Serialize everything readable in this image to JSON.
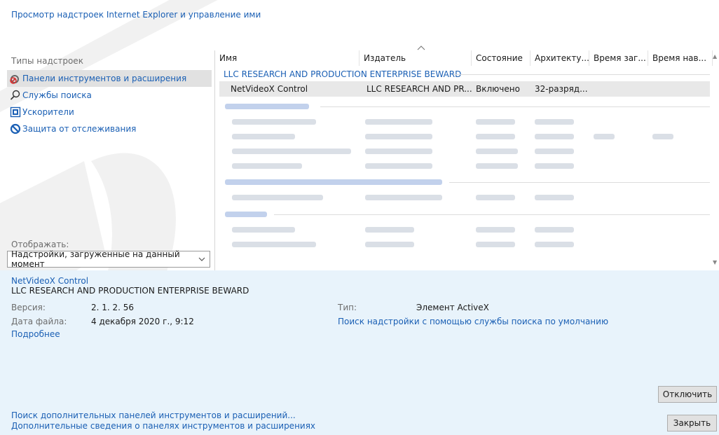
{
  "header": {
    "title": "Просмотр надстроек Internet Explorer и управление ими"
  },
  "left_panel": {
    "types_label": "Типы надстроек",
    "types": [
      {
        "label": "Панели инструментов и расширения",
        "icon": "gear-icon",
        "selected": true
      },
      {
        "label": "Службы поиска",
        "icon": "search-icon",
        "selected": false
      },
      {
        "label": "Ускорители",
        "icon": "accelerator-icon",
        "selected": false
      },
      {
        "label": "Защита от отслеживания",
        "icon": "tracking-protection-icon",
        "selected": false
      }
    ],
    "show_label": "Отображать:",
    "show_value": "Надстройки, загруженные на данный момент"
  },
  "table": {
    "columns": [
      "Имя",
      "Издатель",
      "Состояние",
      "Архитекту...",
      "Время заг...",
      "Время нав..."
    ],
    "groups": [
      {
        "title": "LLC RESEARCH AND PRODUCTION ENTERPRISE BEWARD",
        "rows": [
          {
            "name": "NetVideoX Control",
            "publisher": "LLC RESEARCH AND PR...",
            "status": "Включено",
            "arch": "32-разряд..."
          }
        ]
      }
    ]
  },
  "details": {
    "addon_name": "NetVideoX Control",
    "addon_publisher": "LLC RESEARCH AND PRODUCTION ENTERPRISE BEWARD",
    "version_label": "Версия:",
    "version_value": "2. 1. 2. 56",
    "date_label": "Дата файла:",
    "date_value": "4 декабря 2020 г., 9:12",
    "more_link": "Подробнее",
    "type_label": "Тип:",
    "type_value": "Элемент ActiveX",
    "search_link": "Поиск надстройки с помощью службы поиска по умолчанию",
    "disable_button": "Отключить",
    "close_button": "Закрыть",
    "footer_link_1": "Поиск дополнительных панелей инструментов и расширений...",
    "footer_link_2": "Дополнительные сведения о панелях инструментов и расширениях"
  },
  "colors": {
    "link": "#1a5fb4",
    "details_bg": "#e8f3fb",
    "selected_row": "#e8e8e8"
  }
}
